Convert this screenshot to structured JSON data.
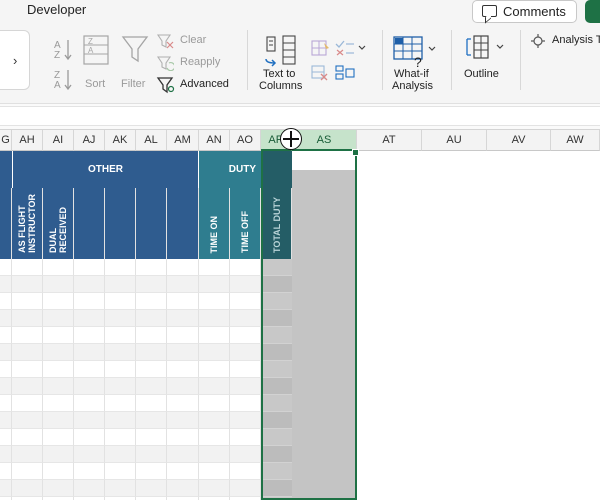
{
  "window": {
    "tab_label": "Developer"
  },
  "top_actions": {
    "comments_label": "Comments"
  },
  "ribbon": {
    "collapse_glyph": "›",
    "sort_label": "Sort",
    "filter_label": "Filter",
    "clear_label": "Clear",
    "reapply_label": "Reapply",
    "advanced_label": "Advanced",
    "text_to_columns_label_1": "Text to",
    "text_to_columns_label_2": "Columns",
    "whatif_label_1": "What-if",
    "whatif_label_2": "Analysis",
    "outline_label": "Outline",
    "analysis_tools_label": "Analysis T"
  },
  "grid": {
    "columns": [
      "G",
      "AH",
      "AI",
      "AJ",
      "AK",
      "AL",
      "AM",
      "AN",
      "AO",
      "AR",
      "AS",
      "AT",
      "AU",
      "AV",
      "AW"
    ],
    "selected_column": "AS",
    "header_other": "OTHER",
    "header_duty": "DUTY",
    "sub_as_flight_instructor": "AS FLIGHT\nINSTRUCTOR",
    "sub_dual_received": "DUAL\nRECEIVED",
    "sub_time_on": "TIME ON",
    "sub_time_off": "TIME OFF",
    "sub_total_duty": "TOTAL DUTY"
  },
  "colors": {
    "accent_green": "#1e7145",
    "header_blue": "#2f5c8f",
    "header_teal": "#2f7d8f",
    "header_teal_dark": "#245d66",
    "selection_fill": "#c6e3cb"
  }
}
